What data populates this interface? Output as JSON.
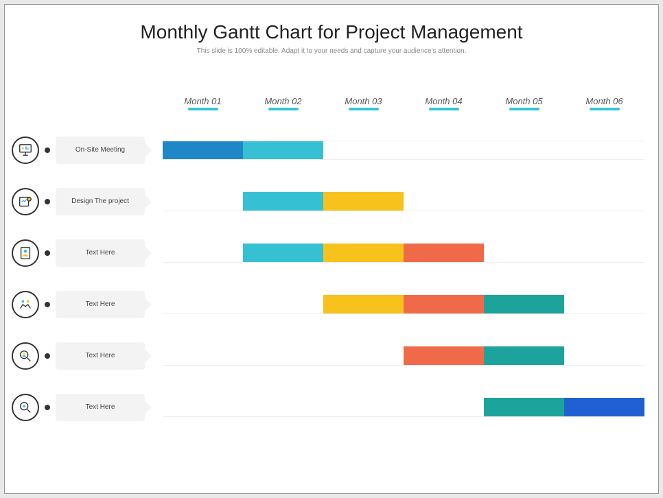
{
  "title": "Monthly Gantt Chart for Project Management",
  "subtitle": "This slide is 100% editable. Adapt it to your needs and capture your audience's attention.",
  "months": [
    "Month 01",
    "Month 02",
    "Month 03",
    "Month 04",
    "Month 05",
    "Month 06"
  ],
  "colors": {
    "blue_dark": "#1f86c7",
    "cyan": "#36c0d3",
    "yellow": "#f7c21b",
    "orange": "#f06a4a",
    "teal": "#1ba39c",
    "blue": "#2060d4"
  },
  "tasks": [
    {
      "label": "On-Site Meeting",
      "icon": "presentation",
      "segments": [
        {
          "start": 0,
          "span": 1,
          "color": "blue_dark"
        },
        {
          "start": 1,
          "span": 1,
          "color": "cyan"
        }
      ]
    },
    {
      "label": "Design The project",
      "icon": "design",
      "segments": [
        {
          "start": 1,
          "span": 1,
          "color": "cyan"
        },
        {
          "start": 2,
          "span": 1,
          "color": "yellow"
        }
      ]
    },
    {
      "label": "Text Here",
      "icon": "profile",
      "segments": [
        {
          "start": 1,
          "span": 1,
          "color": "cyan"
        },
        {
          "start": 2,
          "span": 1,
          "color": "yellow"
        },
        {
          "start": 3,
          "span": 1,
          "color": "orange"
        }
      ]
    },
    {
      "label": "Text Here",
      "icon": "handshake",
      "segments": [
        {
          "start": 2,
          "span": 1,
          "color": "yellow"
        },
        {
          "start": 3,
          "span": 1,
          "color": "orange"
        },
        {
          "start": 4,
          "span": 1,
          "color": "teal"
        }
      ]
    },
    {
      "label": "Text Here",
      "icon": "search-user",
      "segments": [
        {
          "start": 3,
          "span": 1,
          "color": "orange"
        },
        {
          "start": 4,
          "span": 1,
          "color": "teal"
        }
      ]
    },
    {
      "label": "Text Here",
      "icon": "magnify",
      "segments": [
        {
          "start": 4,
          "span": 1,
          "color": "teal"
        },
        {
          "start": 5,
          "span": 1,
          "color": "blue"
        }
      ]
    }
  ],
  "chart_data": {
    "type": "gantt",
    "title": "Monthly Gantt Chart for Project Management",
    "categories": [
      "Month 01",
      "Month 02",
      "Month 03",
      "Month 04",
      "Month 05",
      "Month 06"
    ],
    "xlabel": "",
    "ylabel": "",
    "tasks": [
      {
        "name": "On-Site Meeting",
        "start": 1,
        "end": 2,
        "phases": [
          {
            "month": 1,
            "color": "blue_dark"
          },
          {
            "month": 2,
            "color": "cyan"
          }
        ]
      },
      {
        "name": "Design The project",
        "start": 2,
        "end": 3,
        "phases": [
          {
            "month": 2,
            "color": "cyan"
          },
          {
            "month": 3,
            "color": "yellow"
          }
        ]
      },
      {
        "name": "Text Here",
        "start": 2,
        "end": 4,
        "phases": [
          {
            "month": 2,
            "color": "cyan"
          },
          {
            "month": 3,
            "color": "yellow"
          },
          {
            "month": 4,
            "color": "orange"
          }
        ]
      },
      {
        "name": "Text Here",
        "start": 3,
        "end": 5,
        "phases": [
          {
            "month": 3,
            "color": "yellow"
          },
          {
            "month": 4,
            "color": "orange"
          },
          {
            "month": 5,
            "color": "teal"
          }
        ]
      },
      {
        "name": "Text Here",
        "start": 4,
        "end": 5,
        "phases": [
          {
            "month": 4,
            "color": "orange"
          },
          {
            "month": 5,
            "color": "teal"
          }
        ]
      },
      {
        "name": "Text Here",
        "start": 5,
        "end": 6,
        "phases": [
          {
            "month": 5,
            "color": "teal"
          },
          {
            "month": 6,
            "color": "blue"
          }
        ]
      }
    ]
  }
}
